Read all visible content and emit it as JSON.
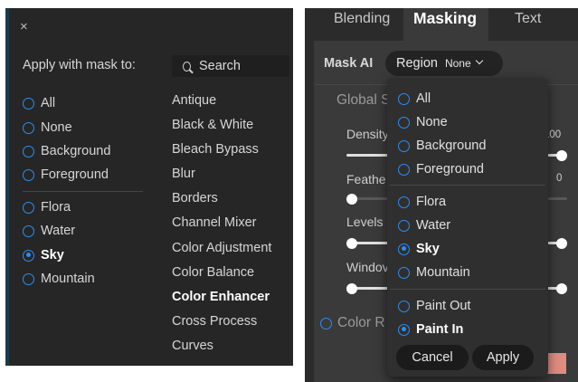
{
  "left_panel": {
    "apply_label": "Apply with mask to:",
    "search": {
      "placeholder": "Search"
    },
    "mask_options": [
      {
        "label": "All",
        "checked": false
      },
      {
        "label": "None",
        "checked": false
      },
      {
        "label": "Background",
        "checked": false
      },
      {
        "label": "Foreground",
        "checked": false
      },
      {
        "label": "Flora",
        "checked": false
      },
      {
        "label": "Water",
        "checked": false
      },
      {
        "label": "Sky",
        "checked": true
      },
      {
        "label": "Mountain",
        "checked": false
      }
    ],
    "presets": [
      "Antique",
      "Black & White",
      "Bleach Bypass",
      "Blur",
      "Borders",
      "Channel Mixer",
      "Color Adjustment",
      "Color Balance",
      "Color Enhancer",
      "Cross Process",
      "Curves"
    ],
    "selected_preset": "Color Enhancer"
  },
  "right_panel": {
    "tabs": [
      {
        "label": "Blending",
        "active": false
      },
      {
        "label": "Masking",
        "active": true
      },
      {
        "label": "Text",
        "active": false
      }
    ],
    "mask_ai_label": "Mask AI",
    "region_label": "Region",
    "region_value": "None",
    "global_label": "Global S",
    "sliders": [
      {
        "label": "Density",
        "value_text": "100",
        "value": 100
      },
      {
        "label": "Feathe",
        "value_text": "0",
        "value": 0
      },
      {
        "label": "Levels",
        "value_text": "",
        "value": null
      },
      {
        "label": "Windov",
        "value_text": "",
        "value": null
      }
    ],
    "color_range_label": "Color R",
    "swatch_color": "#df8c81"
  },
  "dropdown": {
    "groups": [
      [
        {
          "label": "All",
          "checked": false
        },
        {
          "label": "None",
          "checked": false
        },
        {
          "label": "Background",
          "checked": false
        },
        {
          "label": "Foreground",
          "checked": false
        }
      ],
      [
        {
          "label": "Flora",
          "checked": false
        },
        {
          "label": "Water",
          "checked": false
        },
        {
          "label": "Sky",
          "checked": true
        },
        {
          "label": "Mountain",
          "checked": false
        }
      ],
      [
        {
          "label": "Paint Out",
          "checked": false
        },
        {
          "label": "Paint In",
          "checked": true
        }
      ]
    ],
    "cancel_label": "Cancel",
    "apply_label": "Apply"
  },
  "colors": {
    "accent": "#2f8cf0",
    "panel_dark": "#262626",
    "panel": "#3a3a3a"
  }
}
